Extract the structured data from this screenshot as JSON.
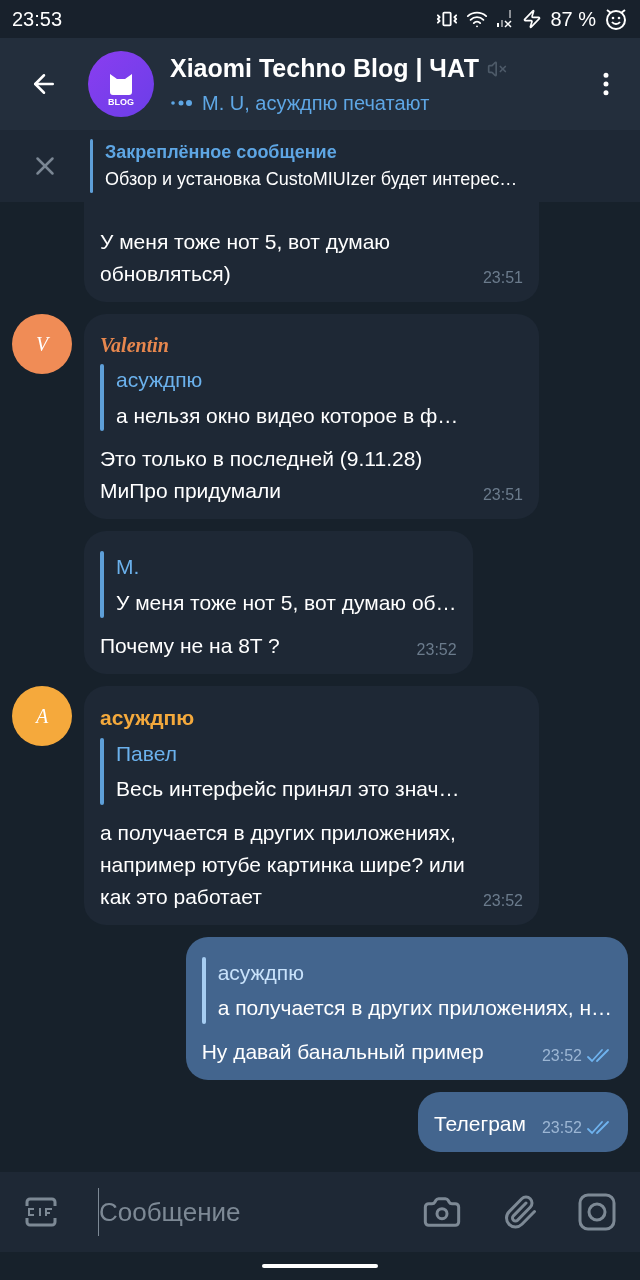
{
  "status_bar": {
    "time": "23:53",
    "battery": "87 %"
  },
  "header": {
    "title": "Xiaomi Techno Blog | ЧАТ",
    "avatar_label": "BLOG",
    "muted": true,
    "typing": "M. U, асуждпю печатают"
  },
  "pinned": {
    "label": "Закреплённое сообщение",
    "text": "Обзор и установка CustoMIUIzer будет интерес…"
  },
  "messages": [
    {
      "kind": "in",
      "clipped": true,
      "text": "У меня тоже нот 5, вот думаю обновляться)",
      "time": "23:51"
    },
    {
      "kind": "in",
      "avatar": {
        "letter": "V",
        "color": "#f08c56"
      },
      "sender": {
        "name": "Valentin",
        "color": "#e7874e",
        "kind": "script"
      },
      "reply": {
        "name": "асуждпю",
        "text": "а нельзя окно видео которое в ф…"
      },
      "text": "Это только в последней (9.11.28) МиПро придумали",
      "time": "23:51"
    },
    {
      "kind": "in",
      "reply": {
        "name": "M.",
        "text": "У меня тоже нот 5, вот думаю об…"
      },
      "text": "Почему не на 8T ?",
      "time": "23:52"
    },
    {
      "kind": "in",
      "avatar": {
        "letter": "A",
        "color": "#f5a93c"
      },
      "sender": {
        "name": "асуждпю",
        "color": "#f4a93c",
        "kind": "plain"
      },
      "reply": {
        "name": "Павел",
        "text": "Весь интерфейс принял это знач…"
      },
      "text": "а получается в других приложениях, например ютубе картинка шире? или как это работает",
      "time": "23:52"
    },
    {
      "kind": "out",
      "reply": {
        "name": "асуждпю",
        "text": "а получается в других приложениях, н…"
      },
      "text": "Ну давай банальный пример",
      "time": "23:52",
      "read": true
    },
    {
      "kind": "out",
      "text": "Телеграм",
      "time": "23:52",
      "read": true
    }
  ],
  "composer": {
    "placeholder": "Сообщение"
  }
}
